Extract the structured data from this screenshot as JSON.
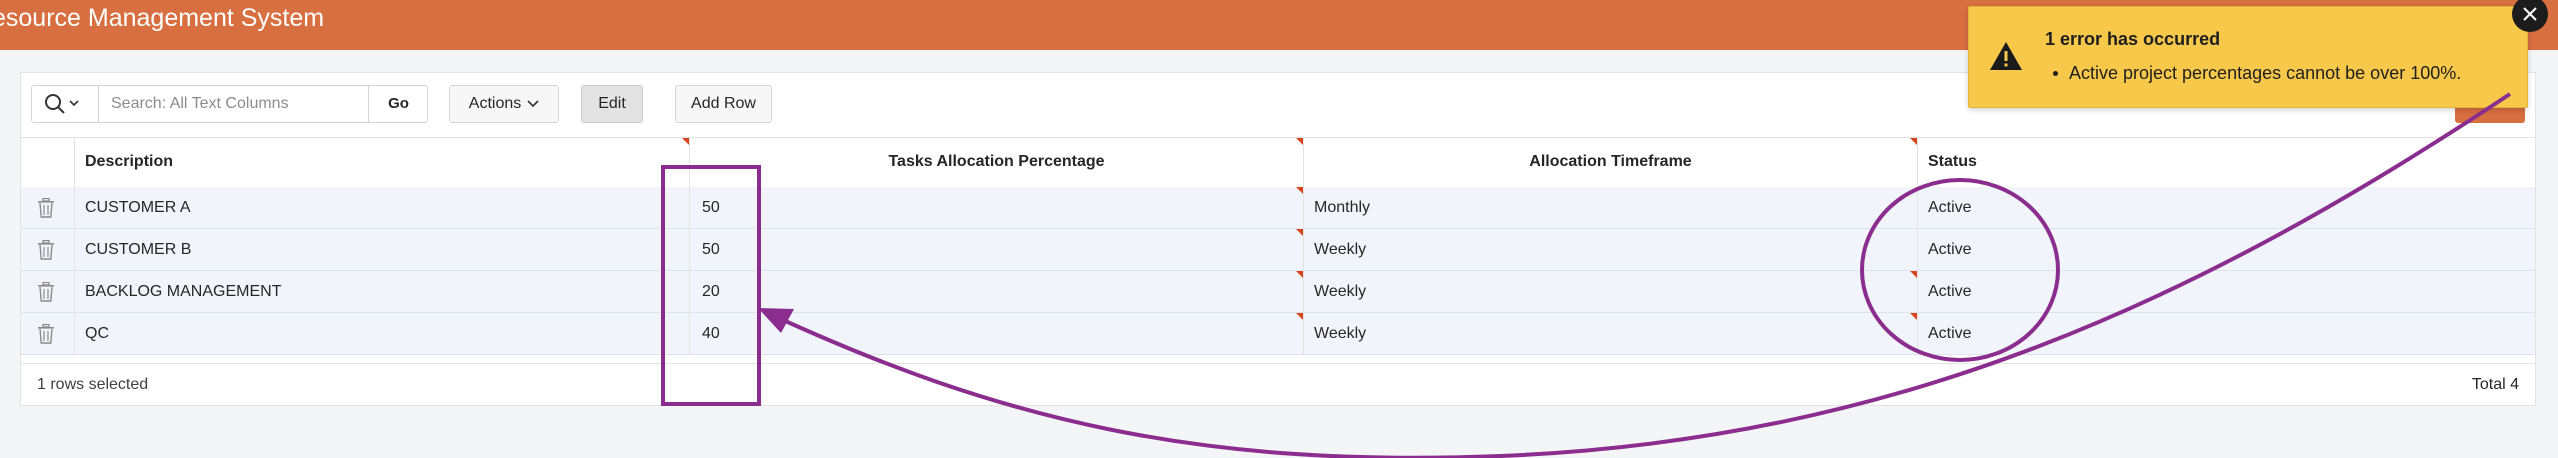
{
  "app": {
    "title": "esource Management System"
  },
  "toolbar": {
    "search_placeholder": "Search: All Text Columns",
    "go_label": "Go",
    "actions_label": "Actions",
    "edit_label": "Edit",
    "add_row_label": "Add Row"
  },
  "grid": {
    "columns": [
      "Description",
      "Tasks Allocation Percentage",
      "Allocation Timeframe",
      "Status"
    ],
    "rows": [
      {
        "description": "CUSTOMER A",
        "percentage": "50",
        "timeframe": "Monthly",
        "status": "Active"
      },
      {
        "description": "CUSTOMER B",
        "percentage": "50",
        "timeframe": "Weekly",
        "status": "Active"
      },
      {
        "description": "BACKLOG MANAGEMENT",
        "percentage": "20",
        "timeframe": "Weekly",
        "status": "Active"
      },
      {
        "description": "QC",
        "percentage": "40",
        "timeframe": "Weekly",
        "status": "Active"
      }
    ],
    "footer": {
      "selected": "1 rows selected",
      "total": "Total 4"
    }
  },
  "notification": {
    "title": "1 error has occurred",
    "message": "Active project percentages cannot be over 100%.",
    "icon": "warning-icon",
    "close_icon": "close-icon"
  },
  "colors": {
    "header": "#d86f41",
    "toast": "#f8c84b",
    "annotation": "#8a2d8f",
    "row": "#f1f5fb"
  }
}
